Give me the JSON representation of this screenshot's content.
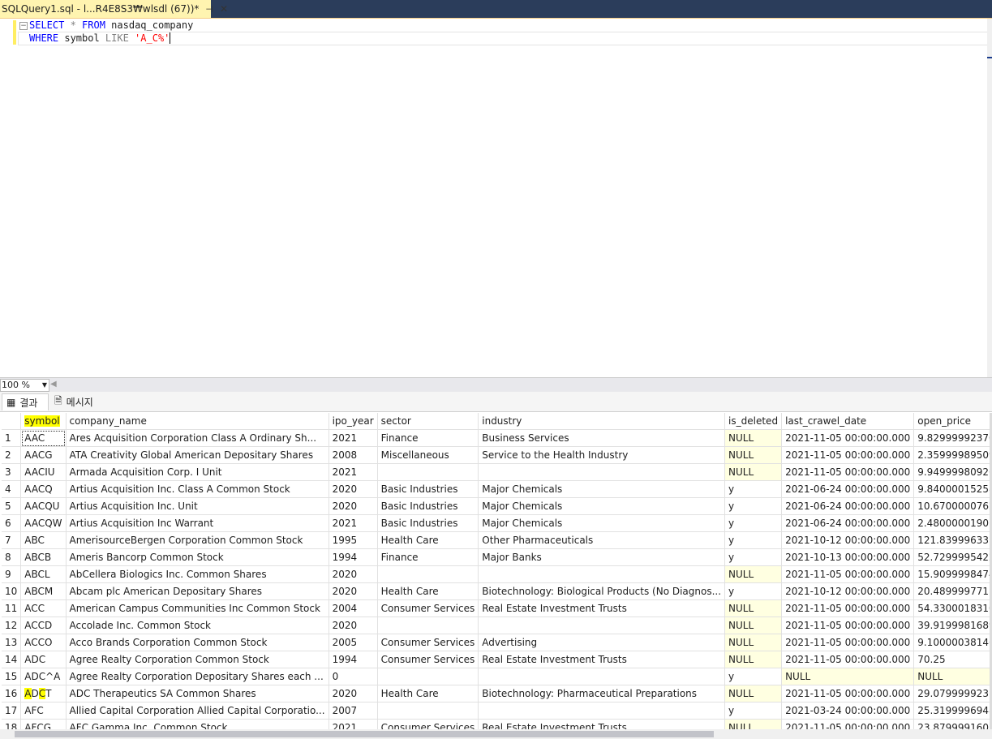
{
  "tab": {
    "title": "SQLQuery1.sql - l...R4E8S3₩wlsdl (67))*",
    "pin": "⊣",
    "close": "✕"
  },
  "editor": {
    "fold": "−",
    "line1": {
      "kw1": "SELECT",
      "star": " * ",
      "kw2": "FROM",
      "rest": " nasdaq_company"
    },
    "line2": {
      "kw1": "WHERE",
      "rest": " symbol ",
      "kw2": "LIKE",
      "str": " 'A_C%'"
    }
  },
  "zoom": {
    "value": "100 %"
  },
  "result_tabs": {
    "results": "결과",
    "messages": "메시지"
  },
  "grid": {
    "columns": [
      "",
      "symbol",
      "company_name",
      "ipo_year",
      "sector",
      "industry",
      "is_deleted",
      "last_crawel_date",
      "open_price"
    ],
    "rows": [
      [
        "1",
        "AAC",
        "Ares Acquisition Corporation Class A Ordinary Sh...",
        "2021",
        "Finance",
        "Business Services",
        "NULL",
        "2021-11-05 00:00:00.000",
        "9.82999992370605"
      ],
      [
        "2",
        "AACG",
        "ATA Creativity Global American Depositary Shares",
        "2008",
        "Miscellaneous",
        "Service to the Health Industry",
        "NULL",
        "2021-11-05 00:00:00.000",
        "2.35999989509583"
      ],
      [
        "3",
        "AACIU",
        "Armada Acquisition Corp. I Unit",
        "2021",
        "",
        "",
        "NULL",
        "2021-11-05 00:00:00.000",
        "9.94999980926514"
      ],
      [
        "4",
        "AACQ",
        "Artius Acquisition Inc. Class A Common Stock",
        "2020",
        "Basic Industries",
        "Major Chemicals",
        "y",
        "2021-06-24 00:00:00.000",
        "9.84000015258789"
      ],
      [
        "5",
        "AACQU",
        "Artius Acquisition Inc. Unit",
        "2020",
        "Basic Industries",
        "Major Chemicals",
        "y",
        "2021-06-24 00:00:00.000",
        "10.6700000762939"
      ],
      [
        "6",
        "AACQW",
        "Artius Acquisition Inc Warrant",
        "2021",
        "Basic Industries",
        "Major Chemicals",
        "y",
        "2021-06-24 00:00:00.000",
        "2.48000001907349"
      ],
      [
        "7",
        "ABC",
        "AmerisourceBergen Corporation Common Stock",
        "1995",
        "Health Care",
        "Other Pharmaceuticals",
        "y",
        "2021-10-12 00:00:00.000",
        "121.839996337891"
      ],
      [
        "8",
        "ABCB",
        "Ameris Bancorp Common Stock",
        "1994",
        "Finance",
        "Major Banks",
        "y",
        "2021-10-13 00:00:00.000",
        "52.7299995422363"
      ],
      [
        "9",
        "ABCL",
        "AbCellera Biologics Inc. Common Shares",
        "2020",
        "",
        "",
        "NULL",
        "2021-11-05 00:00:00.000",
        "15.9099998474121"
      ],
      [
        "10",
        "ABCM",
        "Abcam plc American Depositary Shares",
        "2020",
        "Health Care",
        "Biotechnology: Biological Products (No Diagnos...",
        "y",
        "2021-10-12 00:00:00.000",
        "20.4899997711182"
      ],
      [
        "11",
        "ACC",
        "American Campus Communities Inc Common Stock",
        "2004",
        "Consumer Services",
        "Real Estate Investment Trusts",
        "NULL",
        "2021-11-05 00:00:00.000",
        "54.3300018310547"
      ],
      [
        "12",
        "ACCD",
        "Accolade Inc. Common Stock",
        "2020",
        "",
        "",
        "NULL",
        "2021-11-05 00:00:00.000",
        "39.9199981689453"
      ],
      [
        "13",
        "ACCO",
        "Acco Brands Corporation Common Stock",
        "2005",
        "Consumer Services",
        "Advertising",
        "NULL",
        "2021-11-05 00:00:00.000",
        "9.10000038146973"
      ],
      [
        "14",
        "ADC",
        "Agree Realty Corporation Common Stock",
        "1994",
        "Consumer Services",
        "Real Estate Investment Trusts",
        "NULL",
        "2021-11-05 00:00:00.000",
        "70.25"
      ],
      [
        "15",
        "ADC^A",
        "Agree Realty Corporation Depositary Shares each ...",
        "0",
        "",
        "",
        "y",
        "NULL",
        "NULL"
      ],
      [
        "16",
        "ADCT",
        "ADC Therapeutics SA Common Shares",
        "2020",
        "Health Care",
        "Biotechnology: Pharmaceutical Preparations",
        "NULL",
        "2021-11-05 00:00:00.000",
        "29.0799999237061"
      ],
      [
        "17",
        "AFC",
        "Allied Capital Corporation Allied Capital Corporatio...",
        "2007",
        "",
        "",
        "y",
        "2021-03-24 00:00:00.000",
        "25.3199996948242"
      ],
      [
        "18",
        "AFCG",
        "AFC Gamma Inc. Common Stock",
        "2021",
        "Consumer Services",
        "Real Estate Investment Trusts",
        "NULL",
        "2021-11-05 00:00:00.000",
        "23.8799991607666"
      ]
    ]
  }
}
